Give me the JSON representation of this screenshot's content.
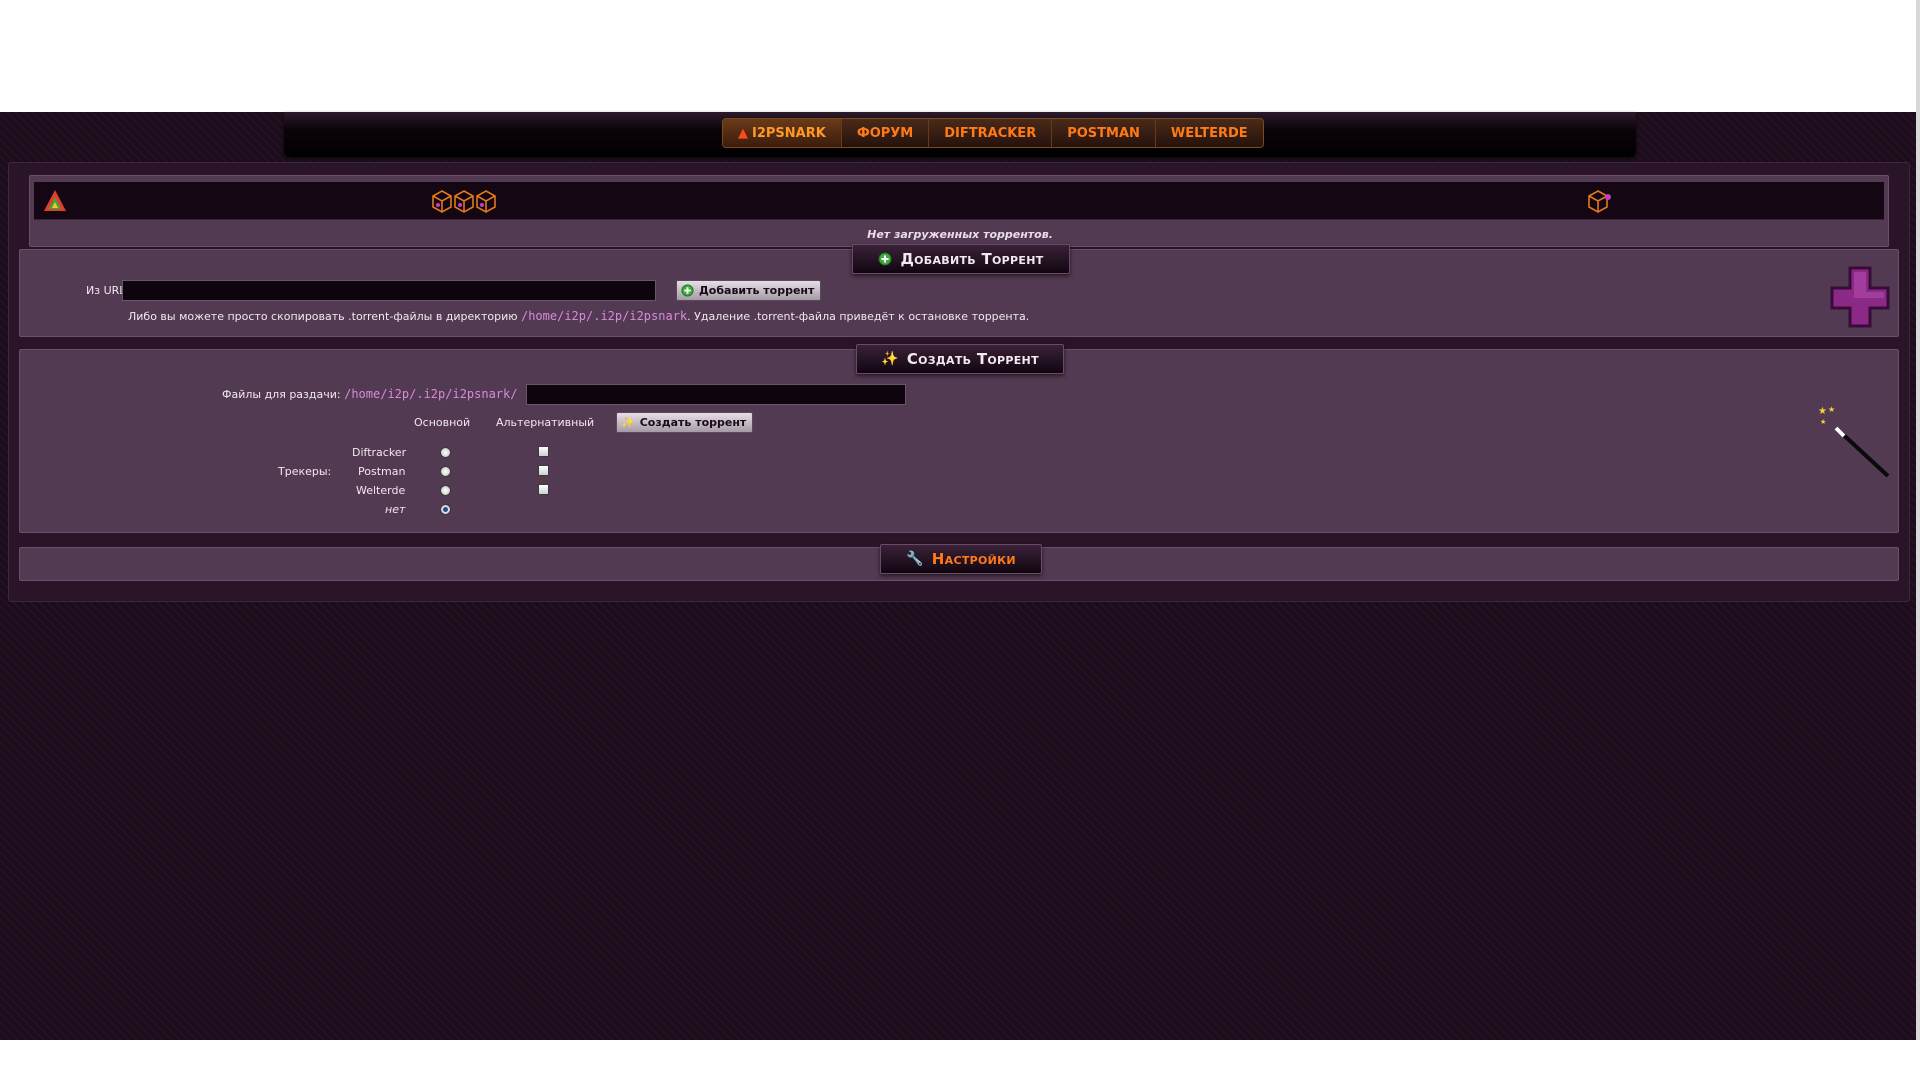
{
  "nav": {
    "items": [
      {
        "label": "I2PSNARK",
        "icon": "i2psnark-logo-icon",
        "active": true
      },
      {
        "label": "ФОРУМ",
        "active": false
      },
      {
        "label": "DIFTRACKER",
        "active": false
      },
      {
        "label": "POSTMAN",
        "active": false
      },
      {
        "label": "WELTERDE",
        "active": false
      }
    ]
  },
  "torrents": {
    "empty_message": "Нет загруженных торрентов.",
    "header_icons": [
      "i2psnark-logo-icon",
      "peers-cubes-icon",
      "cube-icon"
    ]
  },
  "add_torrent": {
    "title": "Добавить Торрент",
    "url_label": "Из URL:",
    "url_value": "",
    "url_placeholder": "",
    "add_button": "Добавить торрент",
    "hint_before": "Либо вы можете просто скопировать .torrent-файлы в директорию",
    "hint_path": "/home/i2p/.i2p/i2psnark",
    "hint_after": ". Удаление .torrent-файла приведёт к остановке торрента."
  },
  "create_torrent": {
    "title": "Создать Торрент",
    "files_label": "Файлы для раздачи:",
    "files_path": "/home/i2p/.i2p/i2psnark/",
    "files_value": "",
    "col_primary": "Основной",
    "col_alternative": "Альтернативный",
    "create_button": "Создать торрент",
    "trackers_label": "Трекеры:",
    "trackers": [
      {
        "name": "Diftracker",
        "primary": false,
        "alternative": false
      },
      {
        "name": "Postman",
        "primary": false,
        "alternative": false
      },
      {
        "name": "Welterde",
        "primary": false,
        "alternative": false
      },
      {
        "name": "нет",
        "primary": true
      }
    ]
  },
  "settings": {
    "title": "Настройки"
  },
  "colors": {
    "background": "#1d0d1c",
    "panel": "#533a53",
    "accent": "#ff7a18",
    "path": "#d88ad8"
  }
}
